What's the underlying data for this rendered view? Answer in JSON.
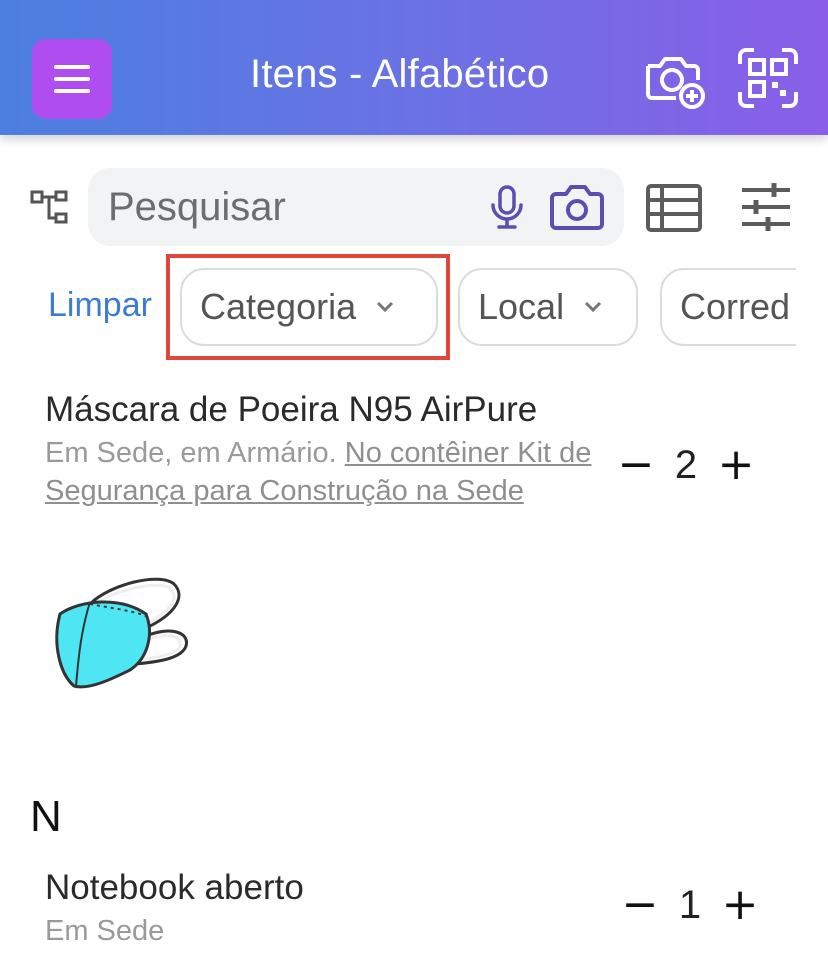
{
  "header": {
    "title": "Itens - Alfabético"
  },
  "search": {
    "placeholder": "Pesquisar"
  },
  "filters": {
    "clear_label": "Limpar",
    "chips": [
      "Categoria",
      "Local",
      "Corred"
    ]
  },
  "items": [
    {
      "name": "Máscara de Poeira N95 AirPure",
      "location_prefix": "Em Sede, em Armário.",
      "container_link": "No contêiner Kit de Segurança para Construção na Sede",
      "quantity": "2",
      "minus": "−",
      "plus": "+"
    }
  ],
  "section": {
    "letter": "N"
  },
  "items_n": [
    {
      "name": "Notebook aberto",
      "location": "Em Sede",
      "quantity": "1",
      "minus": "−",
      "plus": "+"
    }
  ],
  "colors": {
    "header_start": "#4b7fe0",
    "header_end": "#8a5ee8",
    "menu_button": "#b04df0",
    "accent_link": "#3d7bd6",
    "highlight_box": "#e0463a",
    "search_icons": "#5a4fb0"
  },
  "icons": [
    "menu-icon",
    "camera-add-icon",
    "qr-scan-icon",
    "tree-icon",
    "mic-icon",
    "camera-icon",
    "list-view-icon",
    "filter-sliders-icon",
    "chevron-down-icon"
  ]
}
